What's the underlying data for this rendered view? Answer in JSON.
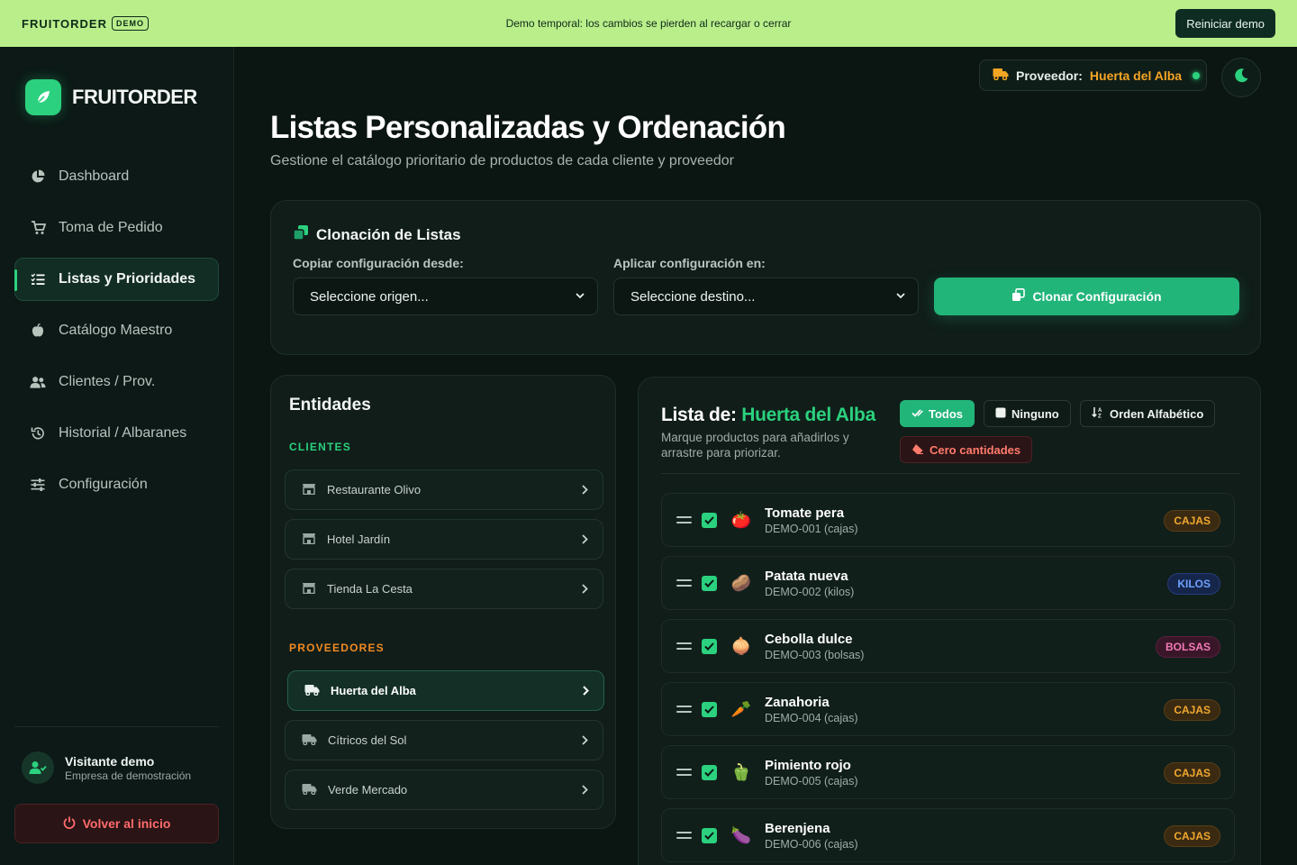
{
  "banner": {
    "brand": "FRUITORDER",
    "demo_tag": "DEMO",
    "message": "Demo temporal: los cambios se pierden al recargar o cerrar",
    "reset_label": "Reiniciar demo"
  },
  "sidebar": {
    "logo_text": "FRUITORDER",
    "items": [
      {
        "label": "Dashboard",
        "icon": "pie-chart-icon"
      },
      {
        "label": "Toma de Pedido",
        "icon": "cart-icon"
      },
      {
        "label": "Listas y Prioridades",
        "icon": "list-icon",
        "active": true
      },
      {
        "label": "Catálogo Maestro",
        "icon": "apple-icon"
      },
      {
        "label": "Clientes / Prov.",
        "icon": "users-icon"
      },
      {
        "label": "Historial / Albaranes",
        "icon": "history-icon"
      },
      {
        "label": "Configuración",
        "icon": "sliders-icon"
      }
    ],
    "user": {
      "name": "Visitante demo",
      "subtitle": "Empresa de demostración"
    },
    "back_label": "Volver al inicio"
  },
  "header": {
    "provider_label": "Proveedor:",
    "provider_value": "Huerta del Alba",
    "title": "Listas Personalizadas y Ordenación",
    "subtitle": "Gestione el catálogo prioritario de productos de cada cliente y proveedor"
  },
  "clone": {
    "title": "Clonación de Listas",
    "source_label": "Copiar configuración desde:",
    "source_value": "Seleccione origen...",
    "target_label": "Aplicar configuración en:",
    "target_value": "Seleccione destino...",
    "button_label": "Clonar Configuración"
  },
  "entities": {
    "title": "Entidades",
    "clients_label": "CLIENTES",
    "clients": [
      "Restaurante Olivo",
      "Hotel Jardín",
      "Tienda La Cesta"
    ],
    "providers_label": "PROVEEDORES",
    "providers": [
      "Huerta del Alba",
      "Cítricos del Sol",
      "Verde Mercado"
    ],
    "active_provider": "Huerta del Alba"
  },
  "list": {
    "title_prefix": "Lista de:",
    "title_entity": "Huerta del Alba",
    "description": "Marque productos para añadirlos y arrastre para priorizar.",
    "btn_all": "Todos",
    "btn_none": "Ninguno",
    "btn_alpha": "Orden Alfabético",
    "btn_zero": "Cero cantidades",
    "products": [
      {
        "name": "Tomate pera",
        "code": "DEMO-001 (cajas)",
        "unit": "CAJAS",
        "emoji": "🍅",
        "checked": true
      },
      {
        "name": "Patata nueva",
        "code": "DEMO-002 (kilos)",
        "unit": "KILOS",
        "emoji": "🥔",
        "checked": true
      },
      {
        "name": "Cebolla dulce",
        "code": "DEMO-003 (bolsas)",
        "unit": "BOLSAS",
        "emoji": "🧅",
        "checked": true
      },
      {
        "name": "Zanahoria",
        "code": "DEMO-004 (cajas)",
        "unit": "CAJAS",
        "emoji": "🥕",
        "checked": true
      },
      {
        "name": "Pimiento rojo",
        "code": "DEMO-005 (cajas)",
        "unit": "CAJAS",
        "emoji": "🫑",
        "checked": true
      },
      {
        "name": "Berenjena",
        "code": "DEMO-006 (cajas)",
        "unit": "CAJAS",
        "emoji": "🍆",
        "checked": true
      }
    ]
  },
  "colors": {
    "accent": "#2bd17e",
    "banner": "#b9ee8b",
    "provider_value": "#f5a524",
    "danger": "#ff6b6b"
  }
}
